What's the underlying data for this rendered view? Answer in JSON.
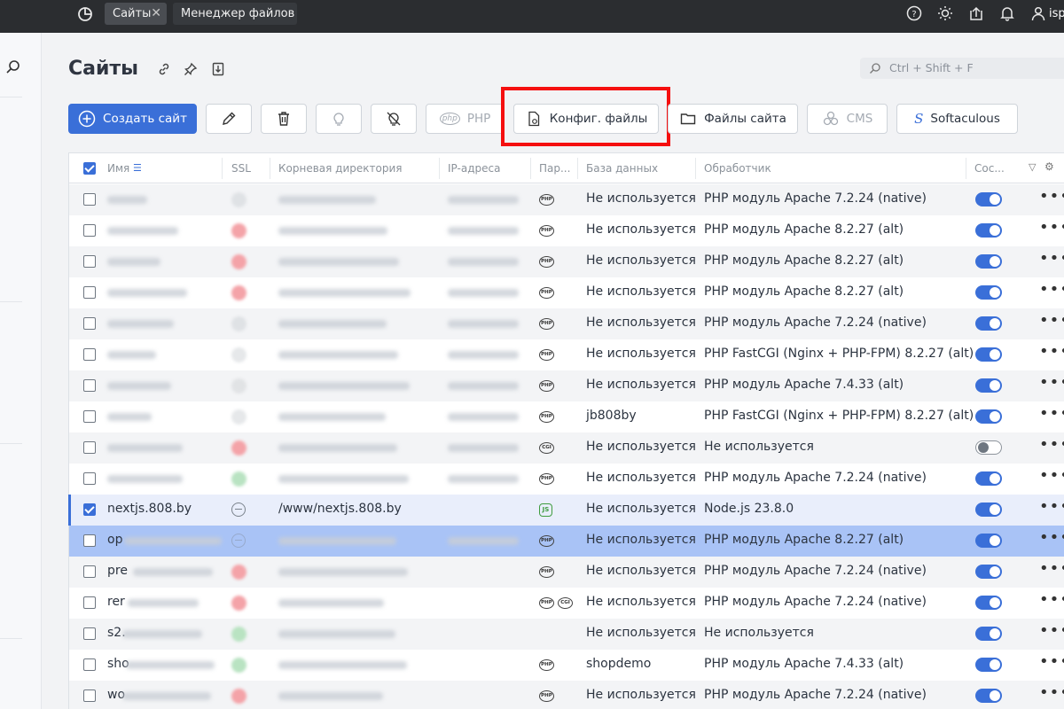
{
  "topbar": {
    "tabs": [
      {
        "label": "Сайты",
        "active": true
      },
      {
        "label": "Менеджер файлов",
        "active": false
      }
    ],
    "user_label": "isp"
  },
  "page": {
    "title": "Сайты",
    "search_placeholder": "Ctrl + Shift + F"
  },
  "toolbar": {
    "create_label": "Создать сайт",
    "php_label": "PHP",
    "config_label": "Конфиг. файлы",
    "site_files_label": "Файлы сайта",
    "cms_label": "CMS",
    "softaculous_label": "Softaculous"
  },
  "columns": {
    "name": "Имя",
    "ssl": "SSL",
    "root": "Корневая директория",
    "ip": "IP-адреса",
    "params": "Пар...",
    "db": "База данных",
    "handler": "Обработчик",
    "status": "Сос..."
  },
  "rows": [
    {
      "name": "",
      "root": "",
      "badges": [
        "PHP"
      ],
      "db": "Не используется",
      "handler": "PHP модуль Apache 7.2.24 (native)",
      "enabled": true
    },
    {
      "name": "",
      "root": "",
      "badges": [
        "PHP"
      ],
      "db": "Не используется",
      "handler": "PHP модуль Apache 8.2.27 (alt)",
      "enabled": true
    },
    {
      "name": "",
      "root": "",
      "badges": [
        "PHP"
      ],
      "db": "Не используется",
      "handler": "PHP модуль Apache 8.2.27 (alt)",
      "enabled": true
    },
    {
      "name": "",
      "root": "",
      "badges": [
        "PHP"
      ],
      "db": "Не используется",
      "handler": "PHP модуль Apache 8.2.27 (alt)",
      "enabled": true
    },
    {
      "name": "",
      "root": "",
      "badges": [
        "PHP"
      ],
      "db": "Не используется",
      "handler": "PHP модуль Apache 7.2.24 (native)",
      "enabled": true
    },
    {
      "name": "",
      "root": "",
      "badges": [
        "PHP"
      ],
      "db": "Не используется",
      "handler": "PHP FastCGI (Nginx + PHP-FPM) 8.2.27 (alt)",
      "enabled": true
    },
    {
      "name": "",
      "root": "",
      "badges": [
        "PHP"
      ],
      "db": "Не используется",
      "handler": "PHP модуль Apache 7.4.33 (alt)",
      "enabled": true
    },
    {
      "name": "",
      "root": "",
      "badges": [
        "PHP"
      ],
      "db": "jb808by",
      "handler": "PHP FastCGI (Nginx + PHP-FPM) 8.2.27 (alt)",
      "enabled": true
    },
    {
      "name": "",
      "root": "",
      "badges": [
        "CGI"
      ],
      "db": "Не используется",
      "handler": "Не используется",
      "enabled": false
    },
    {
      "name": "",
      "root": "",
      "badges": [
        "PHP"
      ],
      "db": "Не используется",
      "handler": "PHP модуль Apache 7.2.24 (native)",
      "enabled": true
    },
    {
      "name": "nextjs.808.by",
      "root": "/www/nextjs.808.by",
      "badges": [
        "JS"
      ],
      "db": "Не используется",
      "handler": "Node.js 23.8.0",
      "enabled": true
    },
    {
      "name": "op",
      "root": "",
      "badges": [
        "PHP"
      ],
      "db": "Не используется",
      "handler": "PHP модуль Apache 8.2.27 (alt)",
      "enabled": true
    },
    {
      "name": "pre",
      "root": "",
      "badges": [
        "PHP"
      ],
      "db": "Не используется",
      "handler": "PHP модуль Apache 7.2.24 (native)",
      "enabled": true
    },
    {
      "name": "rer",
      "root": "",
      "badges": [
        "PHP",
        "CGI"
      ],
      "db": "Не используется",
      "handler": "PHP модуль Apache 7.2.24 (native)",
      "enabled": true
    },
    {
      "name": "s2.",
      "root": "",
      "badges": [],
      "db": "Не используется",
      "handler": "Не используется",
      "enabled": true
    },
    {
      "name": "sho",
      "root": "",
      "badges": [
        "PHP"
      ],
      "db": "shopdemo",
      "handler": "PHP модуль Apache 7.4.33 (alt)",
      "enabled": true
    },
    {
      "name": "wo",
      "root": "",
      "badges": [
        "PHP"
      ],
      "db": "Не используется",
      "handler": "PHP модуль Apache 7.2.24 (native)",
      "enabled": true
    }
  ],
  "icons": {
    "logo": "dashboard-icon",
    "help": "help-icon",
    "theme": "sun-icon",
    "upload": "upload-icon",
    "notifications": "bell-icon",
    "user": "user-icon"
  },
  "colors": {
    "accent": "#3a6fd8",
    "highlight_box": "#f50f0f",
    "selected_row": "#a9c3f6"
  }
}
